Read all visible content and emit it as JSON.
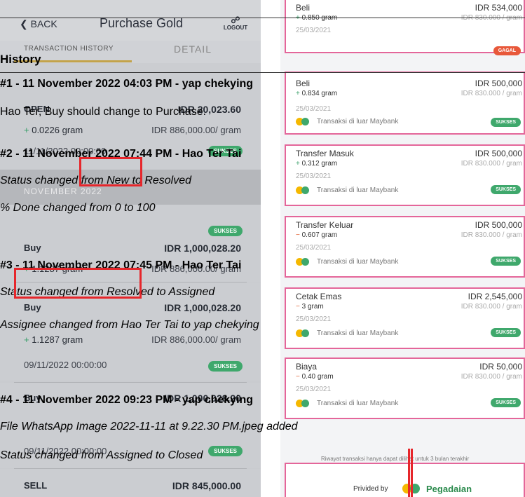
{
  "left_app": {
    "back_label": "BACK",
    "title": "Purchase Gold",
    "logout_label": "LOGOUT",
    "tab_history": "TRANSACTION HISTORY",
    "tab_detail": "DETAIL",
    "month_band": "NOVEMBER 2022",
    "transactions": [
      {
        "label": "OPEN",
        "amount": "IDR 20,023.60",
        "gram": "0.0226 gram",
        "price": "IDR 886,000.00/ gram",
        "date": "11/11/2022 00:00:00",
        "badge": ""
      },
      {
        "label": "Buy",
        "amount": "IDR 1,000,028.20",
        "gram": "1.1287 gram",
        "price": "IDR 886,000.00/ gram",
        "date": "",
        "badge": "SUKSES"
      },
      {
        "label": "Buy",
        "amount": "IDR 1,000,028.20",
        "gram": "1.1287 gram",
        "price": "IDR 886,000.00/ gram",
        "date": "09/11/2022 00:00:00",
        "badge": "SUKSES"
      },
      {
        "label": "Buy",
        "amount": "IDR 1,000,028.20",
        "gram": "",
        "price": "",
        "date": "09/11/2022 00:00:00",
        "badge": "SUKSES"
      },
      {
        "label": "SELL",
        "amount": "IDR 845,000.00",
        "gram": "",
        "price": "",
        "date": "",
        "badge": ""
      }
    ]
  },
  "right_app": {
    "cards": [
      {
        "label": "Beli",
        "amount": "IDR 534,000",
        "sign": "+",
        "gram": "0.850 gram",
        "price": "IDR 830.000 / gram",
        "date": "25/03/2021",
        "bank": "",
        "badge": "GAGAL",
        "badge_type": "fail"
      },
      {
        "label": "Beli",
        "amount": "IDR 500,000",
        "sign": "+",
        "gram": "0.834 gram",
        "price": "IDR 830.000 / gram",
        "date": "25/03/2021",
        "bank": "Transaksi di luar Maybank",
        "badge": "SUKSES",
        "badge_type": "ok"
      },
      {
        "label": "Transfer Masuk",
        "amount": "IDR 500,000",
        "sign": "+",
        "gram": "0.312 gram",
        "price": "IDR 830.000 / gram",
        "date": "25/03/2021",
        "bank": "Transaksi di luar Maybank",
        "badge": "SUKSES",
        "badge_type": "ok"
      },
      {
        "label": "Transfer Keluar",
        "amount": "IDR 500,000",
        "sign": "−",
        "gram": "0.607 gram",
        "price": "IDR 830.000 / gram",
        "date": "25/03/2021",
        "bank": "Transaksi di luar Maybank",
        "badge": "SUKSES",
        "badge_type": "ok"
      },
      {
        "label": "Cetak Emas",
        "amount": "IDR 2,545,000",
        "sign": "−",
        "gram": "3 gram",
        "price": "IDR 830.000 / gram",
        "date": "25/03/2021",
        "bank": "Transaksi di luar Maybank",
        "badge": "SUKSES",
        "badge_type": "ok"
      },
      {
        "label": "Biaya",
        "amount": "IDR 50,000",
        "sign": "−",
        "gram": "0.40 gram",
        "price": "IDR 830.000 / gram",
        "date": "25/03/2021",
        "bank": "Transaksi di luar Maybank",
        "badge": "SUKSES",
        "badge_type": "ok"
      }
    ],
    "note": "Riwayat transaksi hanya dapat dilihat untuk 3 bulan terakhir",
    "provided_by": "Privided by",
    "brand": "Pegadaian"
  },
  "history": {
    "heading": "History",
    "entries": [
      {
        "header": "#1 - 11 November 2022 04:03 PM - yap chekying",
        "lines": [
          "Hao Ter, Buy should change to Purchase."
        ],
        "italic": false
      },
      {
        "header": "#2 - 11 November 2022 07:44 PM - Hao Ter Tai",
        "lines": [
          "Status changed from New to Resolved",
          "% Done changed from 0 to 100"
        ],
        "italic": true
      },
      {
        "header": "#3 - 11 November 2022 07:45 PM - Hao Ter Tai",
        "lines": [
          "Status changed from Resolved to Assigned",
          "Assignee changed from Hao Ter Tai to yap chekying"
        ],
        "italic": true
      },
      {
        "header": "#4 - 11 November 2022 09:23 PM - yap chekying",
        "lines": [
          "File WhatsApp Image 2022-11-11 at 9.22.30 PM.jpeg added",
          "Status changed from Assigned to Closed"
        ],
        "italic": true
      }
    ]
  },
  "colors": {
    "highlight_box": "#e6262b",
    "card_border": "#e4669a",
    "success": "#3fa86c",
    "fail": "#e8583a"
  }
}
